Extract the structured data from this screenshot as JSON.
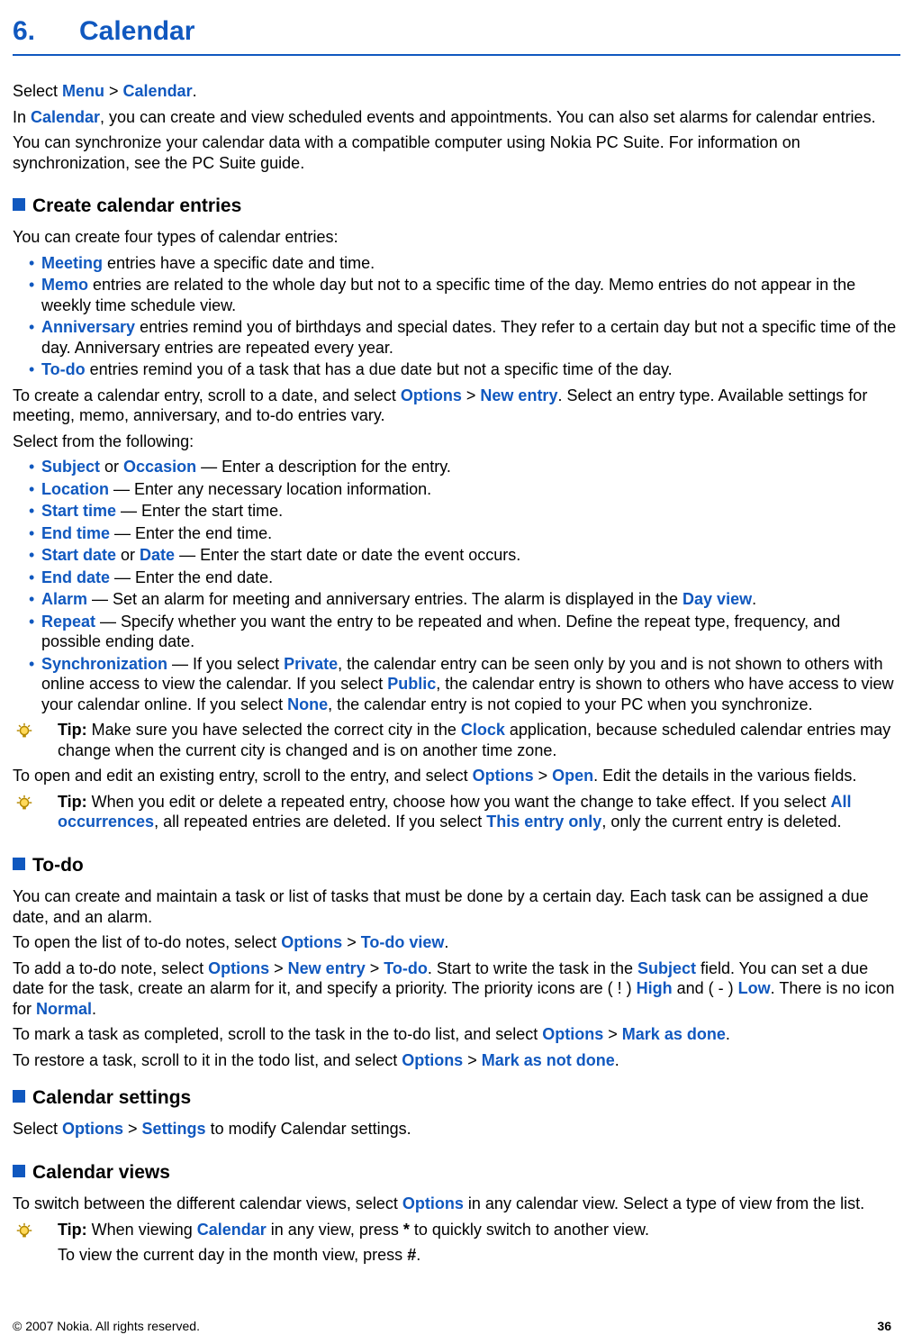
{
  "chapter": {
    "num": "6.",
    "title": "Calendar"
  },
  "intro": {
    "p1_pre": "Select ",
    "p1_t1": "Menu",
    "p1_gt1": " > ",
    "p1_t2": "Calendar",
    "p1_post": ".",
    "p2_pre": "In ",
    "p2_t1": "Calendar",
    "p2_post": ", you can create and view scheduled events and appointments. You can also set alarms for calendar entries.",
    "p3": "You can synchronize your calendar data with a compatible computer using Nokia PC Suite. For information on synchronization, see the PC Suite guide."
  },
  "sec_create": {
    "title": "Create calendar entries",
    "lead": "You can create four types of calendar entries:",
    "types": [
      {
        "term": "Meeting",
        "rest": " entries have a specific date and time."
      },
      {
        "term": "Memo",
        "rest": " entries are related to the whole day but not to a specific time of the day. Memo entries do not appear in the weekly time schedule view."
      },
      {
        "term": "Anniversary",
        "rest": " entries remind you of birthdays and special dates. They refer to a certain day but not a specific time of the day. Anniversary entries are repeated every year."
      },
      {
        "term": "To-do",
        "rest": " entries remind you of a task that has a due date but not a specific time of the day."
      }
    ],
    "p_create_pre": "To create a calendar entry, scroll to a date, and select ",
    "p_create_t1": "Options",
    "p_create_gt": " > ",
    "p_create_t2": "New entry",
    "p_create_post": ". Select an entry type. Available settings for meeting, memo, anniversary, and to-do entries vary.",
    "select_from": "Select from the following:",
    "fields": {
      "f1_t1": "Subject",
      "f1_mid": " or ",
      "f1_t2": "Occasion",
      "f1_rest": " — Enter a description for the entry.",
      "f2_t1": "Location",
      "f2_rest": " — Enter any necessary location information.",
      "f3_t1": "Start time",
      "f3_rest": " — Enter the start time.",
      "f4_t1": "End time",
      "f4_rest": " — Enter the end time.",
      "f5_t1": "Start date",
      "f5_mid": " or ",
      "f5_t2": "Date",
      "f5_rest": " — Enter the start date or date the event occurs.",
      "f6_t1": "End date",
      "f6_rest": " — Enter the end date.",
      "f7_t1": "Alarm",
      "f7_mid": " — Set an alarm for meeting and anniversary entries. The alarm is displayed in the ",
      "f7_t2": "Day view",
      "f7_rest": ".",
      "f8_t1": "Repeat",
      "f8_rest": " — Specify whether you want the entry to be repeated and when. Define the repeat type, frequency, and possible ending date.",
      "f9_t1": "Synchronization",
      "f9_a": " — If you select ",
      "f9_t2": "Private",
      "f9_b": ", the calendar entry can be seen only by you and is not shown to others with online access to view the calendar. If you select ",
      "f9_t3": "Public",
      "f9_c": ", the calendar entry is shown to others who have access to view your calendar online. If you select ",
      "f9_t4": "None",
      "f9_d": ", the calendar entry is not copied to your PC when you synchronize."
    },
    "tip1_label": "Tip:  ",
    "tip1_a": "Make sure you have selected the correct city in the ",
    "tip1_t1": "Clock",
    "tip1_b": " application, because scheduled calendar entries may change when the current city is changed and is on another time zone.",
    "p_open_pre": "To open and edit an existing entry, scroll to the entry, and select ",
    "p_open_t1": "Options",
    "p_open_gt": " > ",
    "p_open_t2": "Open",
    "p_open_post": ". Edit the details in the various fields.",
    "tip2_label": "Tip:  ",
    "tip2_a": "When you edit or delete a repeated entry, choose how you want the change to take effect. If you select ",
    "tip2_t1": "All occurrences",
    "tip2_b": ", all repeated entries are deleted. If you select ",
    "tip2_t2": "This entry only",
    "tip2_c": ", only the current entry is deleted."
  },
  "sec_todo": {
    "title": "To-do",
    "p1": "You can create and maintain a task or list of tasks that must be done by a certain day. Each task can be assigned a due date, and an alarm.",
    "p2_pre": "To open the list of to-do notes, select ",
    "p2_t1": "Options",
    "p2_gt": " > ",
    "p2_t2": "To-do view",
    "p2_post": ".",
    "p3_pre": "To add a to-do note, select ",
    "p3_t1": "Options",
    "p3_gt1": " > ",
    "p3_t2": "New entry",
    "p3_gt2": " > ",
    "p3_t3": "To-do",
    "p3_mid1": ". Start to write the task in the ",
    "p3_t4": "Subject",
    "p3_mid2": " field. You can set a due date for the task, create an alarm for it, and specify a priority. The priority icons are ( ! ) ",
    "p3_t5": "High",
    "p3_mid3": " and ( - ) ",
    "p3_t6": "Low",
    "p3_mid4": ". There is no icon for ",
    "p3_t7": "Normal",
    "p3_post": ".",
    "p4_pre": "To mark a task as completed, scroll to the task in the to-do list, and select ",
    "p4_t1": "Options",
    "p4_gt": " > ",
    "p4_t2": "Mark as done",
    "p4_post": ".",
    "p5_pre": "To restore a task, scroll to it in the todo list, and select ",
    "p5_t1": "Options",
    "p5_gt": " > ",
    "p5_t2": "Mark as not done",
    "p5_post": "."
  },
  "sec_settings": {
    "title": "Calendar settings",
    "p_pre": "Select ",
    "p_t1": "Options",
    "p_gt": " > ",
    "p_t2": "Settings",
    "p_post": " to modify Calendar settings."
  },
  "sec_views": {
    "title": "Calendar views",
    "p1_pre": "To switch between the different calendar views, select ",
    "p1_t1": "Options",
    "p1_post": " in any calendar view. Select a type of view from the list.",
    "tip_label": "Tip: ",
    "tip_a": "When viewing ",
    "tip_t1": "Calendar",
    "tip_b": " in any view, press ",
    "tip_star": "*",
    "tip_c": " to quickly switch to another view.",
    "tip_line2_a": "To view the current day in the month view, press ",
    "tip_hash": "#",
    "tip_line2_b": "."
  },
  "footer": {
    "copyright": "© 2007 Nokia. All rights reserved.",
    "page": "36"
  }
}
